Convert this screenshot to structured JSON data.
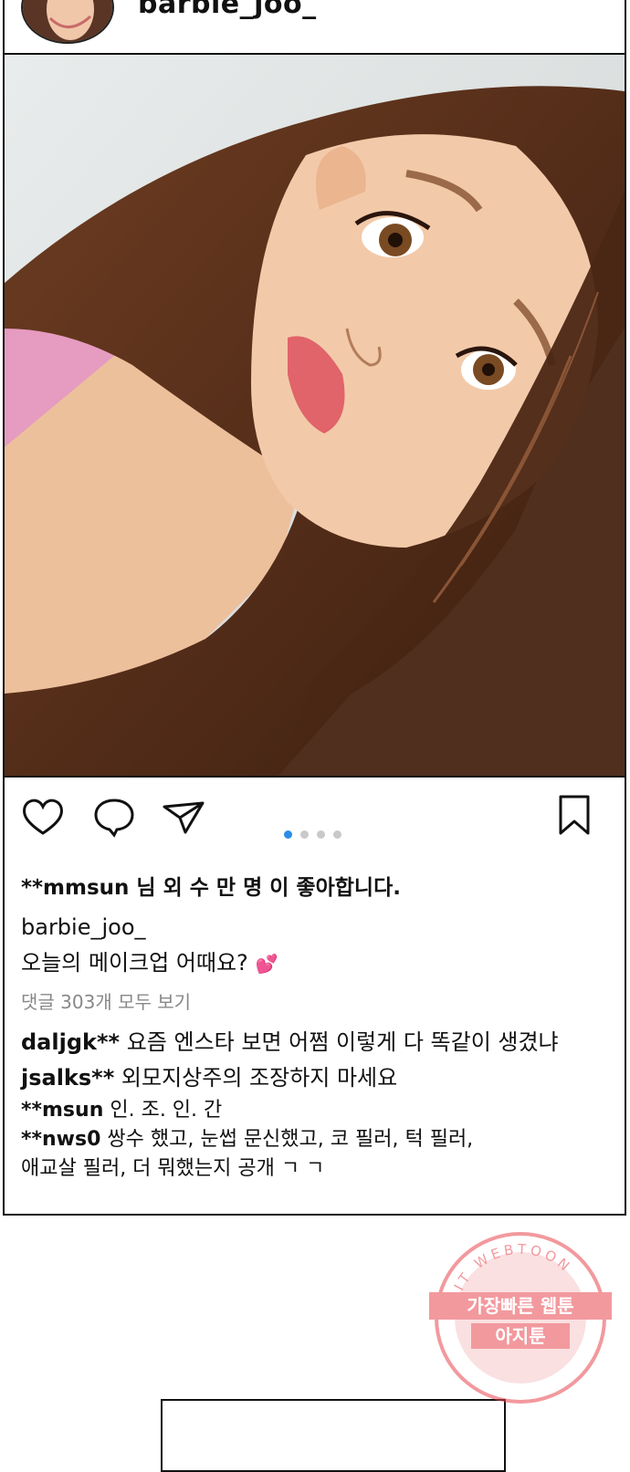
{
  "post": {
    "username": "barbie_joo_",
    "likes_text": "**mmsun 님 외 수 만 명 이 좋아합니다.",
    "caption_user": "barbie_joo_",
    "caption_text": "오늘의 메이크업 어때요?",
    "caption_emoji": "💕",
    "view_all_comments": "댓글 303개 모두 보기",
    "carousel": {
      "total": 4,
      "active": 1
    }
  },
  "comments": [
    {
      "user": "daljgk**",
      "text": "요즘 엔스타 보면 어쩜 이렇게 다 똑같이 생겼냐"
    },
    {
      "user": "jsalks**",
      "text": "외모지상주의 조장하지 마세요"
    },
    {
      "user": "**msun",
      "text": "인. 조. 인. 간"
    },
    {
      "user": "**nws0",
      "text": "쌍수 했고, 눈썹 문신했고, 코 필러, 턱 필러,",
      "text_cont": "애교살 필러, 더 뭐했는지 공개 ㄱ ㄱ"
    }
  ],
  "watermark": {
    "ring_text": "AGIT WEBTOON",
    "line1": "가장빠른 웹툰",
    "line2": "아지툰",
    "color": "#e8474f"
  },
  "icons": {
    "like": "heart-icon",
    "comment": "comment-bubble-icon",
    "share": "paper-plane-icon",
    "save": "bookmark-icon"
  }
}
